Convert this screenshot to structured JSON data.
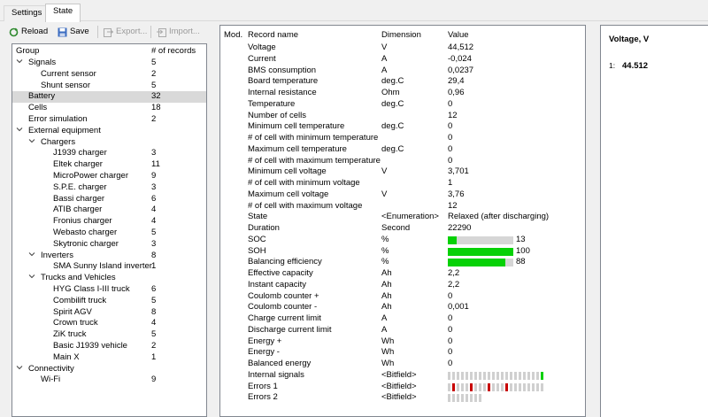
{
  "tabs": [
    "Settings",
    "State"
  ],
  "toolbar": {
    "reload": "Reload",
    "save": "Save",
    "export": "Export...",
    "import": "Import..."
  },
  "tree": {
    "col_group": "Group",
    "col_records": "# of records",
    "rows": [
      {
        "name": "Signals",
        "count": "5",
        "level": 0,
        "exp": "v"
      },
      {
        "name": "Current sensor",
        "count": "2",
        "level": 1,
        "exp": ""
      },
      {
        "name": "Shunt sensor",
        "count": "5",
        "level": 1,
        "exp": ""
      },
      {
        "name": "Battery",
        "count": "32",
        "level": 0,
        "exp": "",
        "selected": true
      },
      {
        "name": "Cells",
        "count": "18",
        "level": 0,
        "exp": ""
      },
      {
        "name": "Error simulation",
        "count": "2",
        "level": 0,
        "exp": ""
      },
      {
        "name": "External equipment",
        "count": "",
        "level": 0,
        "exp": "v"
      },
      {
        "name": "Chargers",
        "count": "",
        "level": 1,
        "exp": "v"
      },
      {
        "name": "J1939 charger",
        "count": "3",
        "level": 2,
        "exp": ""
      },
      {
        "name": "Eltek charger",
        "count": "11",
        "level": 2,
        "exp": ""
      },
      {
        "name": "MicroPower charger",
        "count": "9",
        "level": 2,
        "exp": ""
      },
      {
        "name": "S.P.E. charger",
        "count": "3",
        "level": 2,
        "exp": ""
      },
      {
        "name": "Bassi charger",
        "count": "6",
        "level": 2,
        "exp": ""
      },
      {
        "name": "ATIB charger",
        "count": "4",
        "level": 2,
        "exp": ""
      },
      {
        "name": "Fronius charger",
        "count": "4",
        "level": 2,
        "exp": ""
      },
      {
        "name": "Webasto charger",
        "count": "5",
        "level": 2,
        "exp": ""
      },
      {
        "name": "Skytronic charger",
        "count": "3",
        "level": 2,
        "exp": ""
      },
      {
        "name": "Inverters",
        "count": "8",
        "level": 1,
        "exp": "v"
      },
      {
        "name": "SMA Sunny Island inverter",
        "count": "1",
        "level": 2,
        "exp": ""
      },
      {
        "name": "Trucks and Vehicles",
        "count": "",
        "level": 1,
        "exp": "v"
      },
      {
        "name": "HYG Class I-III truck",
        "count": "6",
        "level": 2,
        "exp": ""
      },
      {
        "name": "Combilift truck",
        "count": "5",
        "level": 2,
        "exp": ""
      },
      {
        "name": "Spirit AGV",
        "count": "8",
        "level": 2,
        "exp": ""
      },
      {
        "name": "Crown truck",
        "count": "4",
        "level": 2,
        "exp": ""
      },
      {
        "name": "ZiK truck",
        "count": "5",
        "level": 2,
        "exp": ""
      },
      {
        "name": "Basic J1939 vehicle",
        "count": "2",
        "level": 2,
        "exp": ""
      },
      {
        "name": "Main X",
        "count": "1",
        "level": 2,
        "exp": ""
      },
      {
        "name": "Connectivity",
        "count": "",
        "level": 0,
        "exp": "v"
      },
      {
        "name": "Wi-Fi",
        "count": "9",
        "level": 1,
        "exp": ""
      }
    ]
  },
  "records": {
    "col_mod": "Mod.",
    "col_name": "Record name",
    "col_dim": "Dimension",
    "col_val": "Value",
    "rows": [
      {
        "name": "Voltage",
        "dim": "V",
        "value": "44,512"
      },
      {
        "name": "Current",
        "dim": "A",
        "value": "-0,024"
      },
      {
        "name": "BMS consumption",
        "dim": "A",
        "value": "0,0237"
      },
      {
        "name": "Board temperature",
        "dim": "deg.C",
        "value": "29,4"
      },
      {
        "name": "Internal resistance",
        "dim": "Ohm",
        "value": "0,96"
      },
      {
        "name": "Temperature",
        "dim": "deg.C",
        "value": "0"
      },
      {
        "name": "Number of cells",
        "dim": "",
        "value": "12"
      },
      {
        "name": "Minimum cell temperature",
        "dim": "deg.C",
        "value": "0"
      },
      {
        "name": "# of cell with minimum temperature",
        "dim": "",
        "value": "0"
      },
      {
        "name": "Maximum cell temperature",
        "dim": "deg.C",
        "value": "0"
      },
      {
        "name": "# of cell with maximum temperature",
        "dim": "",
        "value": "0"
      },
      {
        "name": "Minimum cell voltage",
        "dim": "V",
        "value": "3,701"
      },
      {
        "name": "# of cell with minimum voltage",
        "dim": "",
        "value": "1"
      },
      {
        "name": "Maximum cell voltage",
        "dim": "V",
        "value": "3,76"
      },
      {
        "name": "# of cell with maximum voltage",
        "dim": "",
        "value": "12"
      },
      {
        "name": "State",
        "dim": "<Enumeration>",
        "value": "Relaxed (after discharging)"
      },
      {
        "name": "Duration",
        "dim": "Second",
        "value": "22290"
      },
      {
        "name": "SOC",
        "dim": "%",
        "value": "13",
        "bar": 13
      },
      {
        "name": "SOH",
        "dim": "%",
        "value": "100",
        "bar": 100
      },
      {
        "name": "Balancing efficiency",
        "dim": "%",
        "value": "88",
        "bar": 88
      },
      {
        "name": "Effective capacity",
        "dim": "Ah",
        "value": "2,2"
      },
      {
        "name": "Instant capacity",
        "dim": "Ah",
        "value": "2,2"
      },
      {
        "name": "Coulomb counter +",
        "dim": "Ah",
        "value": "0"
      },
      {
        "name": "Coulomb counter -",
        "dim": "Ah",
        "value": "0,001"
      },
      {
        "name": "Charge current limit",
        "dim": "A",
        "value": "0"
      },
      {
        "name": "Discharge current limit",
        "dim": "A",
        "value": "0"
      },
      {
        "name": "Energy +",
        "dim": "Wh",
        "value": "0"
      },
      {
        "name": "Energy -",
        "dim": "Wh",
        "value": "0"
      },
      {
        "name": "Balanced energy",
        "dim": "Wh",
        "value": "0"
      },
      {
        "name": "Internal signals",
        "dim": "<Bitfield>",
        "value": "",
        "bits": "000000000000000000000G"
      },
      {
        "name": "Errors 1",
        "dim": "<Bitfield>",
        "value": "",
        "bits": "0R000R000R000R00000000"
      },
      {
        "name": "Errors 2",
        "dim": "<Bitfield>",
        "value": "",
        "bits": "00000000"
      }
    ]
  },
  "detail": {
    "title": "Voltage, V",
    "index": "1:",
    "value": "44.512"
  },
  "colors": {
    "bar_fill": "#06d106",
    "bar_bg": "#d6d6d6",
    "bit_off": "#d0d0d0",
    "bit_on": "#06d106",
    "bit_error": "#c80000",
    "selection": "#d9d9d9"
  }
}
